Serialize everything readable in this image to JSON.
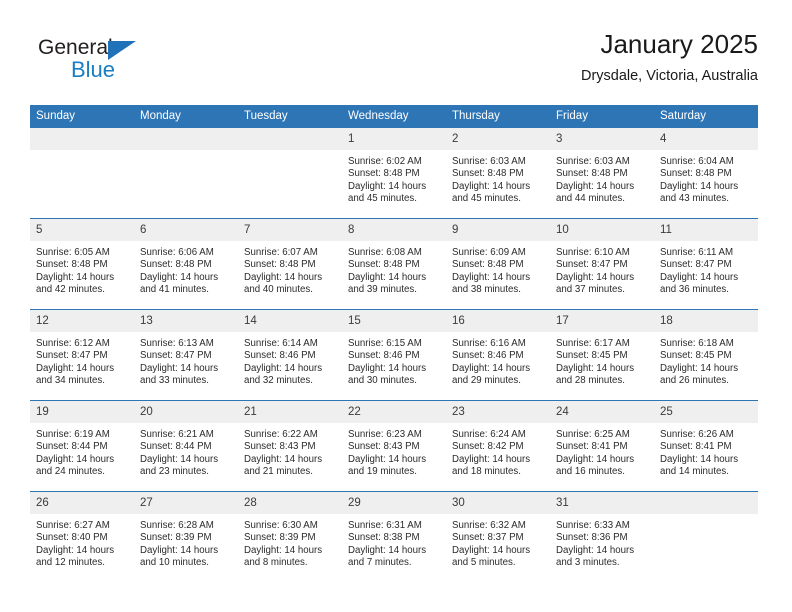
{
  "brand": {
    "name_top": "General",
    "name_bottom": "Blue",
    "accent_color": "#1b7dc4",
    "triangle_icon": "brand-triangle-icon"
  },
  "header": {
    "title": "January 2025",
    "location": "Drysdale, Victoria, Australia"
  },
  "theme": {
    "header_blue": "#2e75b6",
    "daynum_band": "#efefef",
    "text": "#2b2b2b"
  },
  "weekday_headers": [
    "Sunday",
    "Monday",
    "Tuesday",
    "Wednesday",
    "Thursday",
    "Friday",
    "Saturday"
  ],
  "labels": {
    "sunrise": "Sunrise:",
    "sunset": "Sunset:",
    "daylight": "Daylight:"
  },
  "weeks": [
    [
      {
        "day": "",
        "blank": true,
        "sunrise": "",
        "sunset": "",
        "daylight": ""
      },
      {
        "day": "",
        "blank": true,
        "sunrise": "",
        "sunset": "",
        "daylight": ""
      },
      {
        "day": "",
        "blank": true,
        "sunrise": "",
        "sunset": "",
        "daylight": ""
      },
      {
        "day": "1",
        "blank": false,
        "sunrise": "Sunrise: 6:02 AM",
        "sunset": "Sunset: 8:48 PM",
        "daylight": "Daylight: 14 hours and 45 minutes."
      },
      {
        "day": "2",
        "blank": false,
        "sunrise": "Sunrise: 6:03 AM",
        "sunset": "Sunset: 8:48 PM",
        "daylight": "Daylight: 14 hours and 45 minutes."
      },
      {
        "day": "3",
        "blank": false,
        "sunrise": "Sunrise: 6:03 AM",
        "sunset": "Sunset: 8:48 PM",
        "daylight": "Daylight: 14 hours and 44 minutes."
      },
      {
        "day": "4",
        "blank": false,
        "sunrise": "Sunrise: 6:04 AM",
        "sunset": "Sunset: 8:48 PM",
        "daylight": "Daylight: 14 hours and 43 minutes."
      }
    ],
    [
      {
        "day": "5",
        "blank": false,
        "sunrise": "Sunrise: 6:05 AM",
        "sunset": "Sunset: 8:48 PM",
        "daylight": "Daylight: 14 hours and 42 minutes."
      },
      {
        "day": "6",
        "blank": false,
        "sunrise": "Sunrise: 6:06 AM",
        "sunset": "Sunset: 8:48 PM",
        "daylight": "Daylight: 14 hours and 41 minutes."
      },
      {
        "day": "7",
        "blank": false,
        "sunrise": "Sunrise: 6:07 AM",
        "sunset": "Sunset: 8:48 PM",
        "daylight": "Daylight: 14 hours and 40 minutes."
      },
      {
        "day": "8",
        "blank": false,
        "sunrise": "Sunrise: 6:08 AM",
        "sunset": "Sunset: 8:48 PM",
        "daylight": "Daylight: 14 hours and 39 minutes."
      },
      {
        "day": "9",
        "blank": false,
        "sunrise": "Sunrise: 6:09 AM",
        "sunset": "Sunset: 8:48 PM",
        "daylight": "Daylight: 14 hours and 38 minutes."
      },
      {
        "day": "10",
        "blank": false,
        "sunrise": "Sunrise: 6:10 AM",
        "sunset": "Sunset: 8:47 PM",
        "daylight": "Daylight: 14 hours and 37 minutes."
      },
      {
        "day": "11",
        "blank": false,
        "sunrise": "Sunrise: 6:11 AM",
        "sunset": "Sunset: 8:47 PM",
        "daylight": "Daylight: 14 hours and 36 minutes."
      }
    ],
    [
      {
        "day": "12",
        "blank": false,
        "sunrise": "Sunrise: 6:12 AM",
        "sunset": "Sunset: 8:47 PM",
        "daylight": "Daylight: 14 hours and 34 minutes."
      },
      {
        "day": "13",
        "blank": false,
        "sunrise": "Sunrise: 6:13 AM",
        "sunset": "Sunset: 8:47 PM",
        "daylight": "Daylight: 14 hours and 33 minutes."
      },
      {
        "day": "14",
        "blank": false,
        "sunrise": "Sunrise: 6:14 AM",
        "sunset": "Sunset: 8:46 PM",
        "daylight": "Daylight: 14 hours and 32 minutes."
      },
      {
        "day": "15",
        "blank": false,
        "sunrise": "Sunrise: 6:15 AM",
        "sunset": "Sunset: 8:46 PM",
        "daylight": "Daylight: 14 hours and 30 minutes."
      },
      {
        "day": "16",
        "blank": false,
        "sunrise": "Sunrise: 6:16 AM",
        "sunset": "Sunset: 8:46 PM",
        "daylight": "Daylight: 14 hours and 29 minutes."
      },
      {
        "day": "17",
        "blank": false,
        "sunrise": "Sunrise: 6:17 AM",
        "sunset": "Sunset: 8:45 PM",
        "daylight": "Daylight: 14 hours and 28 minutes."
      },
      {
        "day": "18",
        "blank": false,
        "sunrise": "Sunrise: 6:18 AM",
        "sunset": "Sunset: 8:45 PM",
        "daylight": "Daylight: 14 hours and 26 minutes."
      }
    ],
    [
      {
        "day": "19",
        "blank": false,
        "sunrise": "Sunrise: 6:19 AM",
        "sunset": "Sunset: 8:44 PM",
        "daylight": "Daylight: 14 hours and 24 minutes."
      },
      {
        "day": "20",
        "blank": false,
        "sunrise": "Sunrise: 6:21 AM",
        "sunset": "Sunset: 8:44 PM",
        "daylight": "Daylight: 14 hours and 23 minutes."
      },
      {
        "day": "21",
        "blank": false,
        "sunrise": "Sunrise: 6:22 AM",
        "sunset": "Sunset: 8:43 PM",
        "daylight": "Daylight: 14 hours and 21 minutes."
      },
      {
        "day": "22",
        "blank": false,
        "sunrise": "Sunrise: 6:23 AM",
        "sunset": "Sunset: 8:43 PM",
        "daylight": "Daylight: 14 hours and 19 minutes."
      },
      {
        "day": "23",
        "blank": false,
        "sunrise": "Sunrise: 6:24 AM",
        "sunset": "Sunset: 8:42 PM",
        "daylight": "Daylight: 14 hours and 18 minutes."
      },
      {
        "day": "24",
        "blank": false,
        "sunrise": "Sunrise: 6:25 AM",
        "sunset": "Sunset: 8:41 PM",
        "daylight": "Daylight: 14 hours and 16 minutes."
      },
      {
        "day": "25",
        "blank": false,
        "sunrise": "Sunrise: 6:26 AM",
        "sunset": "Sunset: 8:41 PM",
        "daylight": "Daylight: 14 hours and 14 minutes."
      }
    ],
    [
      {
        "day": "26",
        "blank": false,
        "sunrise": "Sunrise: 6:27 AM",
        "sunset": "Sunset: 8:40 PM",
        "daylight": "Daylight: 14 hours and 12 minutes."
      },
      {
        "day": "27",
        "blank": false,
        "sunrise": "Sunrise: 6:28 AM",
        "sunset": "Sunset: 8:39 PM",
        "daylight": "Daylight: 14 hours and 10 minutes."
      },
      {
        "day": "28",
        "blank": false,
        "sunrise": "Sunrise: 6:30 AM",
        "sunset": "Sunset: 8:39 PM",
        "daylight": "Daylight: 14 hours and 8 minutes."
      },
      {
        "day": "29",
        "blank": false,
        "sunrise": "Sunrise: 6:31 AM",
        "sunset": "Sunset: 8:38 PM",
        "daylight": "Daylight: 14 hours and 7 minutes."
      },
      {
        "day": "30",
        "blank": false,
        "sunrise": "Sunrise: 6:32 AM",
        "sunset": "Sunset: 8:37 PM",
        "daylight": "Daylight: 14 hours and 5 minutes."
      },
      {
        "day": "31",
        "blank": false,
        "sunrise": "Sunrise: 6:33 AM",
        "sunset": "Sunset: 8:36 PM",
        "daylight": "Daylight: 14 hours and 3 minutes."
      },
      {
        "day": "",
        "blank": true,
        "sunrise": "",
        "sunset": "",
        "daylight": ""
      }
    ]
  ]
}
